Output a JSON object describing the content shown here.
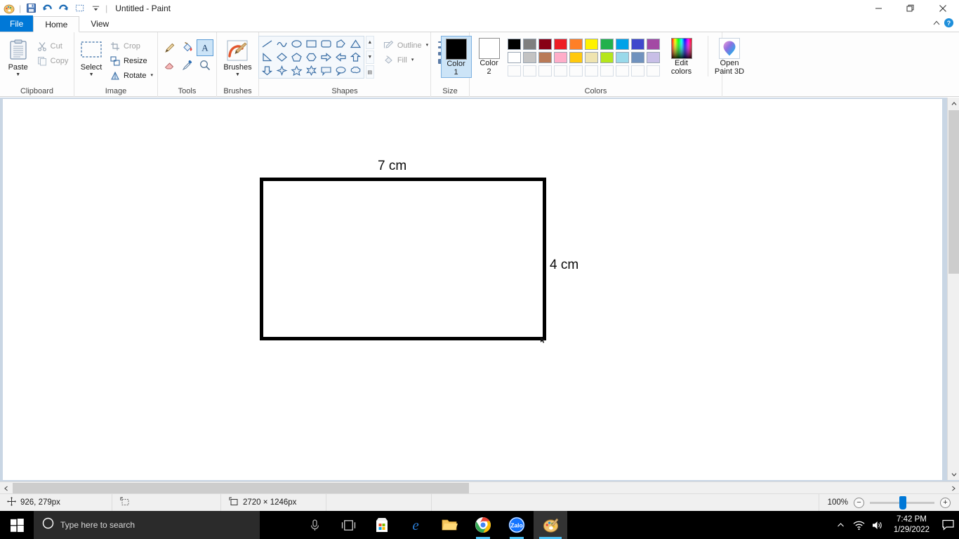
{
  "window": {
    "title": "Untitled - Paint",
    "quick_access": [
      {
        "name": "paint-app-icon",
        "label": "Paint"
      },
      {
        "name": "save-icon",
        "label": "Save"
      },
      {
        "name": "undo-icon",
        "label": "Undo"
      },
      {
        "name": "redo-icon",
        "label": "Redo"
      },
      {
        "name": "select-qat-icon",
        "label": "Select"
      },
      {
        "name": "customize-qat-icon",
        "label": "Customize Quick Access Toolbar"
      }
    ],
    "controls": {
      "minimize": "Minimize",
      "maximize": "Restore Down",
      "close": "Close",
      "collapse_ribbon": "Minimize the Ribbon",
      "help": "Help"
    }
  },
  "tabs": [
    {
      "label": "File",
      "state": "file"
    },
    {
      "label": "Home",
      "state": "active"
    },
    {
      "label": "View",
      "state": "inactive"
    }
  ],
  "ribbon": {
    "groups": [
      {
        "label": "Clipboard",
        "big": {
          "label": "Paste",
          "icon": "paste-icon",
          "has_caret": true
        },
        "small": [
          {
            "label": "Cut",
            "icon": "cut-icon",
            "disabled": true
          },
          {
            "label": "Copy",
            "icon": "copy-icon",
            "disabled": true
          }
        ]
      },
      {
        "label": "Image",
        "big": {
          "label": "Select",
          "icon": "select-icon",
          "has_caret": true
        },
        "small": [
          {
            "label": "Crop",
            "icon": "crop-icon",
            "disabled": true
          },
          {
            "label": "Resize",
            "icon": "resize-icon",
            "disabled": false
          },
          {
            "label": "Rotate",
            "icon": "rotate-icon",
            "disabled": false,
            "has_caret": true
          }
        ]
      },
      {
        "label": "Tools",
        "tools": [
          {
            "name": "pencil-tool",
            "label": "Pencil",
            "selected": false
          },
          {
            "name": "fill-with-color-tool",
            "label": "Fill with color",
            "selected": false
          },
          {
            "name": "text-tool",
            "label": "Text",
            "selected": true
          },
          {
            "name": "eraser-tool",
            "label": "Eraser",
            "selected": false
          },
          {
            "name": "color-picker-tool",
            "label": "Color picker",
            "selected": false
          },
          {
            "name": "magnifier-tool",
            "label": "Magnifier",
            "selected": false
          }
        ]
      },
      {
        "label": "Brushes",
        "big": {
          "label": "Brushes",
          "icon": "brushes-icon",
          "has_caret": true
        }
      },
      {
        "label": "Shapes",
        "shapes": [
          "line",
          "curve",
          "oval",
          "rectangle",
          "rounded-rectangle",
          "polygon",
          "triangle",
          "right-triangle",
          "diamond",
          "pentagon",
          "hexagon",
          "right-arrow",
          "left-arrow",
          "up-arrow",
          "down-arrow",
          "four-point-star",
          "five-point-star",
          "six-point-star",
          "rounded-callout",
          "oval-callout",
          "cloud-callout"
        ],
        "outline": {
          "label": "Outline",
          "disabled": true,
          "has_caret": true
        },
        "fill": {
          "label": "Fill",
          "disabled": true,
          "has_caret": true
        }
      },
      {
        "label": "Size",
        "big": {
          "label": "Size",
          "icon": "size-icon",
          "has_caret": true
        }
      },
      {
        "label": "Colors",
        "color1": {
          "label_line1": "Color",
          "label_line2": "1",
          "value": "#000000",
          "selected": true
        },
        "color2": {
          "label_line1": "Color",
          "label_line2": "2",
          "value": "#ffffff",
          "selected": false
        },
        "palette_row1": [
          "#000000",
          "#7f7f7f",
          "#880015",
          "#ed1c24",
          "#ff7f27",
          "#fff200",
          "#22b14c",
          "#00a2e8",
          "#3f48cc",
          "#a349a4"
        ],
        "palette_row2": [
          "#ffffff",
          "#c3c3c3",
          "#b97a57",
          "#ffaec9",
          "#ffc90e",
          "#efe4b0",
          "#b5e61d",
          "#99d9ea",
          "#7092be",
          "#c8bfe7"
        ],
        "palette_row3": [
          "",
          "",
          "",
          "",
          "",
          "",
          "",
          "",
          "",
          ""
        ],
        "edit_colors": {
          "line1": "Edit",
          "line2": "colors",
          "icon": "edit-colors-icon"
        },
        "open_paint3d": {
          "line1": "Open",
          "line2": "Paint 3D",
          "icon": "paint3d-icon"
        }
      }
    ]
  },
  "canvas": {
    "shape": {
      "name": "rectangle-shape",
      "stroke_color": "#000000",
      "fill_color": "#ffffff",
      "top_label": "7 cm",
      "right_label": "4 cm"
    }
  },
  "status_bar": {
    "cursor_position": "926, 279px",
    "cursor_icon": "cursor-position-icon",
    "selection_size_icon": "selection-size-icon",
    "selection_size": "",
    "image_size_icon": "image-size-icon",
    "image_size": "2720 × 1246px",
    "zoom_level": "100%",
    "zoom_out": "−",
    "zoom_in": "+"
  },
  "taskbar": {
    "start": "start-button",
    "search_placeholder": "Type here to search",
    "search_icon": "cortana-circle-icon",
    "mic_icon": "microphone-icon",
    "items": [
      {
        "name": "task-view-icon",
        "label": "Task View",
        "state": "idle"
      },
      {
        "name": "microsoft-store-icon",
        "label": "Microsoft Store",
        "state": "idle"
      },
      {
        "name": "edge-icon",
        "label": "Microsoft Edge",
        "state": "idle"
      },
      {
        "name": "file-explorer-icon",
        "label": "File Explorer",
        "state": "idle"
      },
      {
        "name": "chrome-icon",
        "label": "Google Chrome",
        "state": "open"
      },
      {
        "name": "zalo-icon",
        "label": "Zalo",
        "state": "open"
      },
      {
        "name": "paint-taskbar-icon",
        "label": "Paint",
        "state": "active"
      }
    ],
    "tray": {
      "show_hidden": "show-hidden-icons-chevron",
      "network": "wifi-icon",
      "volume": "speaker-icon",
      "time": "7:42 PM",
      "date": "1/29/2022",
      "action_center": "action-center-icon"
    }
  }
}
